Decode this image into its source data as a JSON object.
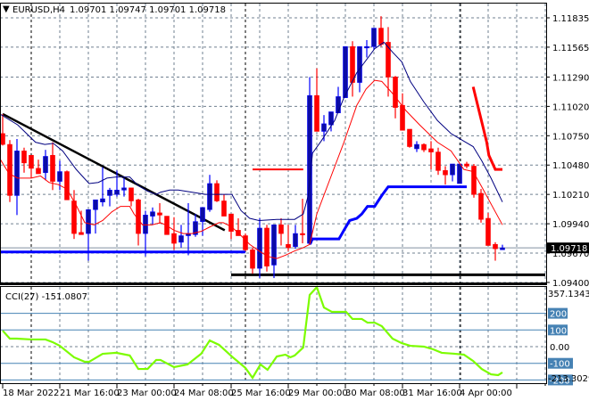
{
  "header": {
    "symbol_timeframe": "EURUSD,H4",
    "ohlc": "1.09701 1.09747 1.09701 1.09718"
  },
  "colors": {
    "bull": "#0b0ba6",
    "bull_wick": "#0000ff",
    "bear": "#ff0000",
    "ma_blue": "#000080",
    "ma_red": "#ff0000",
    "cci": "#7cfc00",
    "level": "#4682b4",
    "grid": "#708090"
  },
  "price_axis": {
    "labels": [
      "1.11835",
      "1.11565",
      "1.11290",
      "1.11020",
      "1.10750",
      "1.10480",
      "1.10210",
      "1.09940",
      "1.09670",
      "1.09400"
    ],
    "range": [
      1.094,
      1.11835
    ],
    "current_price": "1.09718"
  },
  "time_axis": {
    "labels": [
      "18 Mar 2022",
      "21 Mar 16:00",
      "23 Mar 00:00",
      "24 Mar 08:00",
      "25 Mar 16:00",
      "29 Mar 00:00",
      "30 Mar 08:00",
      "31 Mar 16:00",
      "4 Apr 00:00"
    ]
  },
  "candles": [
    [
      1.1077,
      1.1095,
      1.1066,
      1.1067
    ],
    [
      1.1067,
      1.1071,
      1.1014,
      1.102
    ],
    [
      1.102,
      1.1072,
      1.1002,
      1.1061
    ],
    [
      1.1061,
      1.1064,
      1.1041,
      1.105
    ],
    [
      1.1057,
      1.1057,
      1.1036,
      1.1045
    ],
    [
      1.1045,
      1.1053,
      1.104,
      1.104
    ],
    [
      1.1041,
      1.1062,
      1.1034,
      1.1056
    ],
    [
      1.1057,
      1.1069,
      1.1025,
      1.1033
    ],
    [
      1.1033,
      1.1052,
      1.1025,
      1.1042
    ],
    [
      1.1042,
      1.1043,
      1.1016,
      1.1016
    ],
    [
      1.1015,
      1.1025,
      1.098,
      1.0985
    ],
    [
      1.0986,
      1.1006,
      1.0984,
      1.0984
    ],
    [
      1.0985,
      1.1007,
      1.096,
      1.1007
    ],
    [
      1.1007,
      1.1016,
      1.0985,
      1.1016
    ],
    [
      1.1014,
      1.1046,
      1.101,
      1.1017
    ],
    [
      1.102,
      1.1027,
      1.101,
      1.1025
    ],
    [
      1.1021,
      1.1043,
      1.1019,
      1.1025
    ],
    [
      1.1025,
      1.1036,
      1.1019,
      1.1027
    ],
    [
      1.1027,
      1.1027,
      1.101,
      1.1015
    ],
    [
      1.1016,
      1.1017,
      1.0974,
      1.0985
    ],
    [
      1.0985,
      1.1006,
      1.0964,
      1.1002
    ],
    [
      1.1001,
      1.1009,
      1.0993,
      1.1005
    ],
    [
      1.1004,
      1.1013,
      1.0994,
      1.1002
    ],
    [
      1.1001,
      1.1001,
      1.0986,
      1.0984
    ],
    [
      1.0985,
      1.1,
      1.097,
      1.0976
    ],
    [
      1.0977,
      1.0993,
      1.0972,
      1.0983
    ],
    [
      1.0983,
      1.1013,
      1.0965,
      1.0985
    ],
    [
      1.0984,
      1.1003,
      1.0982,
      1.0996
    ],
    [
      1.0996,
      1.1009,
      1.0983,
      1.1009
    ],
    [
      1.1007,
      1.1039,
      1.1005,
      1.1031
    ],
    [
      1.1031,
      1.1034,
      1.1014,
      1.1015
    ],
    [
      1.1015,
      1.1021,
      1.101,
      1.1001
    ],
    [
      1.1003,
      1.1003,
      1.098,
      1.0987
    ],
    [
      1.0988,
      1.0999,
      1.0983,
      1.0983
    ],
    [
      1.0983,
      1.0985,
      1.0969,
      1.097
    ],
    [
      1.097,
      1.0972,
      1.0948,
      1.0953
    ],
    [
      1.0953,
      1.0999,
      1.0944,
      1.099
    ],
    [
      1.099,
      1.0993,
      1.095,
      1.0955
    ],
    [
      1.0956,
      1.0993,
      1.0944,
      1.0993
    ],
    [
      1.0993,
      1.0999,
      1.0974,
      1.0985
    ],
    [
      1.0975,
      1.0993,
      1.0969,
      1.0972
    ],
    [
      1.0973,
      1.0993,
      1.0971,
      1.0985
    ],
    [
      1.0985,
      1.1017,
      1.0976,
      1.0984
    ],
    [
      1.0976,
      1.1129,
      1.0975,
      1.1112
    ],
    [
      1.1112,
      1.1137,
      1.1079,
      1.1079
    ],
    [
      1.1079,
      1.1094,
      1.107,
      1.1086
    ],
    [
      1.1085,
      1.1097,
      1.1079,
      1.1097
    ],
    [
      1.1096,
      1.112,
      1.1096,
      1.1111
    ],
    [
      1.111,
      1.1157,
      1.111,
      1.1157
    ],
    [
      1.1157,
      1.1162,
      1.1111,
      1.1124
    ],
    [
      1.1124,
      1.1157,
      1.1115,
      1.1157
    ],
    [
      1.1156,
      1.1163,
      1.1147,
      1.1157
    ],
    [
      1.1157,
      1.1174,
      1.1154,
      1.1174
    ],
    [
      1.1174,
      1.1185,
      1.1157,
      1.1159
    ],
    [
      1.1161,
      1.1175,
      1.1111,
      1.1129
    ],
    [
      1.1129,
      1.113,
      1.1091,
      1.1101
    ],
    [
      1.1103,
      1.1114,
      1.108,
      1.108
    ],
    [
      1.1081,
      1.1081,
      1.1064,
      1.1065
    ],
    [
      1.1063,
      1.107,
      1.106,
      1.1067
    ],
    [
      1.1067,
      1.1068,
      1.106,
      1.1062
    ],
    [
      1.1063,
      1.107,
      1.1044,
      1.106
    ],
    [
      1.106,
      1.1064,
      1.1039,
      1.1043
    ],
    [
      1.1043,
      1.1047,
      1.103,
      1.1039
    ],
    [
      1.1039,
      1.1049,
      1.1033,
      1.1049
    ],
    [
      1.1031,
      1.1049,
      1.1031,
      1.1049
    ],
    [
      1.1049,
      1.1051,
      1.1045,
      1.1047
    ],
    [
      1.1047,
      1.1049,
      1.1018,
      1.1021
    ],
    [
      1.1022,
      1.1026,
      1.0995,
      1.0998
    ],
    [
      1.0999,
      1.1004,
      1.0974,
      1.0974
    ],
    [
      1.0975,
      1.0977,
      1.096,
      1.0971
    ],
    [
      1.09701,
      1.09747,
      1.09701,
      1.09718
    ]
  ],
  "ma_blue": [
    [
      -0.4,
      1.1095
    ],
    [
      2.1,
      1.1085
    ],
    [
      4.6,
      1.1069
    ],
    [
      5.9,
      1.1067
    ],
    [
      7.1,
      1.1068
    ],
    [
      8.4,
      1.1061
    ],
    [
      10.3,
      1.1044
    ],
    [
      12.1,
      1.1031
    ],
    [
      13.4,
      1.1032
    ],
    [
      14.6,
      1.1036
    ],
    [
      15.9,
      1.1037
    ],
    [
      17.8,
      1.1037
    ],
    [
      19,
      1.1029
    ],
    [
      20.3,
      1.1024
    ],
    [
      21.5,
      1.1021
    ],
    [
      22.1,
      1.1023
    ],
    [
      23.4,
      1.1025
    ],
    [
      24.6,
      1.1025
    ],
    [
      28.4,
      1.1021
    ],
    [
      32.1,
      1.1021
    ],
    [
      33.4,
      1.1006
    ],
    [
      34.6,
      1.0999
    ],
    [
      35.9,
      1.0997
    ],
    [
      38.4,
      1.0998
    ],
    [
      40.9,
      1.0998
    ],
    [
      42.1,
      1.1003
    ],
    [
      42.8,
      1.102
    ],
    [
      43.4,
      1.1059
    ],
    [
      44.6,
      1.107
    ],
    [
      46.5,
      1.1089
    ],
    [
      47.8,
      1.111
    ],
    [
      49.6,
      1.1133
    ],
    [
      52.1,
      1.1155
    ],
    [
      53.4,
      1.1161
    ],
    [
      54.6,
      1.1152
    ],
    [
      55.9,
      1.1143
    ],
    [
      57.1,
      1.1125
    ],
    [
      59,
      1.1106
    ],
    [
      60.9,
      1.1089
    ],
    [
      62.8,
      1.1077
    ],
    [
      64.6,
      1.107
    ],
    [
      65.9,
      1.1065
    ],
    [
      67.1,
      1.1052
    ],
    [
      68.4,
      1.1036
    ],
    [
      70,
      1.1014
    ]
  ],
  "ma_red": [
    [
      -0.4,
      1.1054
    ],
    [
      0.9,
      1.104
    ],
    [
      2.1,
      1.1036
    ],
    [
      4,
      1.1036
    ],
    [
      5.3,
      1.1038
    ],
    [
      6.5,
      1.1032
    ],
    [
      7.8,
      1.103
    ],
    [
      9,
      1.1026
    ],
    [
      10.3,
      1.1011
    ],
    [
      11.5,
      1.0995
    ],
    [
      12.8,
      1.0993
    ],
    [
      14,
      1.0997
    ],
    [
      15.3,
      1.1005
    ],
    [
      16.5,
      1.101
    ],
    [
      17.8,
      1.101
    ],
    [
      18.4,
      1.1003
    ],
    [
      19.6,
      1.0993
    ],
    [
      20.9,
      1.0993
    ],
    [
      22.1,
      1.0995
    ],
    [
      22.8,
      1.0993
    ],
    [
      24,
      1.0988
    ],
    [
      25.3,
      1.0985
    ],
    [
      26.5,
      1.0985
    ],
    [
      27.8,
      1.0987
    ],
    [
      29,
      1.0991
    ],
    [
      30.3,
      1.0995
    ],
    [
      30.9,
      1.0995
    ],
    [
      32.1,
      1.0991
    ],
    [
      33.4,
      1.0983
    ],
    [
      34.6,
      1.0975
    ],
    [
      35.9,
      1.0969
    ],
    [
      37.1,
      1.0964
    ],
    [
      38.4,
      1.0962
    ],
    [
      39.6,
      1.0965
    ],
    [
      40.9,
      1.0969
    ],
    [
      42.1,
      1.0972
    ],
    [
      43,
      1.0975
    ],
    [
      44,
      1.1003
    ],
    [
      45.9,
      1.1036
    ],
    [
      47.8,
      1.1069
    ],
    [
      49.6,
      1.1103
    ],
    [
      50.9,
      1.1118
    ],
    [
      52.1,
      1.1126
    ],
    [
      53.1,
      1.1125
    ],
    [
      54.6,
      1.1114
    ],
    [
      56.5,
      1.1098
    ],
    [
      58.4,
      1.1085
    ],
    [
      60.9,
      1.1069
    ],
    [
      62.8,
      1.1061
    ],
    [
      64.6,
      1.1044
    ],
    [
      65.9,
      1.1042
    ],
    [
      67.1,
      1.1028
    ],
    [
      69,
      1.1005
    ],
    [
      70,
      1.0993
    ]
  ],
  "drawings": {
    "trendline": [
      [
        0,
        1.1095
      ],
      [
        31.1,
        1.0988
      ]
    ],
    "support_blue": [
      [
        -0.4,
        1.0968
      ],
      [
        34,
        1.0968
      ]
    ],
    "support_black": [
      [
        32,
        1.0947
      ],
      [
        76,
        1.0947
      ]
    ],
    "resistance_red": [
      [
        35,
        1.1044
      ],
      [
        42.1,
        1.1044
      ]
    ],
    "step_blue": [
      [
        43,
        1.0975
      ],
      [
        43.4,
        1.098
      ],
      [
        47.1,
        1.098
      ],
      [
        47.8,
        1.0988
      ],
      [
        48.6,
        1.0997
      ],
      [
        49.6,
        1.0999
      ],
      [
        50.3,
        1.1003
      ],
      [
        51.1,
        1.101
      ],
      [
        52.1,
        1.101
      ],
      [
        53.1,
        1.102
      ],
      [
        54,
        1.1028
      ],
      [
        65,
        1.1028
      ]
    ],
    "step_red": [
      [
        65.9,
        1.112
      ],
      [
        67.8,
        1.1069
      ],
      [
        68.1,
        1.1057
      ],
      [
        69,
        1.1044
      ],
      [
        70,
        1.1044
      ]
    ]
  },
  "cci": {
    "label": "CCI(27) -151.0807",
    "max_label": "357.1343",
    "min_label": "-213.3029",
    "levels": [
      "200",
      "100",
      "-100",
      "-200"
    ],
    "zero_label": "0.00",
    "values": [
      [
        0,
        96
      ],
      [
        1,
        48
      ],
      [
        2,
        48
      ],
      [
        4,
        43
      ],
      [
        6,
        43
      ],
      [
        7,
        27
      ],
      [
        8,
        5
      ],
      [
        10,
        -64
      ],
      [
        11.5,
        -91
      ],
      [
        12.1,
        -91
      ],
      [
        14,
        -43
      ],
      [
        15.9,
        -37
      ],
      [
        17.8,
        -53
      ],
      [
        19,
        -134
      ],
      [
        20.3,
        -134
      ],
      [
        21.5,
        -80
      ],
      [
        22.1,
        -80
      ],
      [
        24,
        -123
      ],
      [
        25.9,
        -107
      ],
      [
        27.8,
        -43
      ],
      [
        29,
        37
      ],
      [
        30.3,
        11
      ],
      [
        32.1,
        -59
      ],
      [
        34,
        -128
      ],
      [
        35,
        -187
      ],
      [
        36.1,
        -107
      ],
      [
        37.1,
        -139
      ],
      [
        38.4,
        -59
      ],
      [
        39.6,
        -48
      ],
      [
        40.3,
        -64
      ],
      [
        40.9,
        -53
      ],
      [
        42.1,
        -5
      ],
      [
        43,
        310
      ],
      [
        44,
        357
      ],
      [
        45,
        235
      ],
      [
        46.1,
        209
      ],
      [
        48.1,
        209
      ],
      [
        49,
        166
      ],
      [
        50.3,
        166
      ],
      [
        51.1,
        144
      ],
      [
        52.1,
        144
      ],
      [
        53.1,
        123
      ],
      [
        54.6,
        48
      ],
      [
        55.9,
        21
      ],
      [
        57.1,
        5
      ],
      [
        59,
        0
      ],
      [
        60.3,
        -16
      ],
      [
        61.5,
        -37
      ],
      [
        63.4,
        -43
      ],
      [
        64.6,
        -48
      ],
      [
        65.9,
        -86
      ],
      [
        67.1,
        -134
      ],
      [
        68.4,
        -166
      ],
      [
        69.4,
        -171
      ],
      [
        70,
        -155
      ]
    ]
  }
}
